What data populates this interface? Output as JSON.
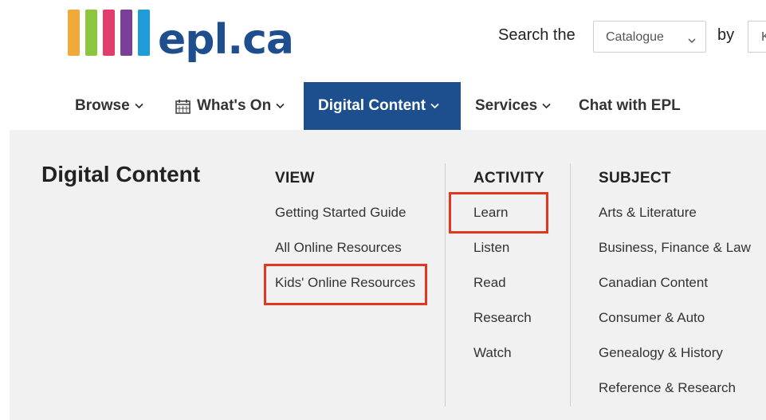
{
  "logo": {
    "text": "epl.ca",
    "bar_colors": [
      "#f2a93b",
      "#8cc63f",
      "#e23e6d",
      "#7a3f98",
      "#1f9bd7"
    ],
    "text_color": "#1f4e8f"
  },
  "search": {
    "label": "Search the",
    "scope_value": "Catalogue",
    "by_label": "by",
    "by_value": "K"
  },
  "nav": {
    "items": [
      {
        "label": "Browse",
        "icon": "chevron-down-icon"
      },
      {
        "label": "What's On",
        "icon": "calendar-icon"
      },
      {
        "label": "Digital Content",
        "icon": "chevron-down-icon"
      },
      {
        "label": "Services",
        "icon": "chevron-down-icon"
      },
      {
        "label": "Chat with EPL"
      }
    ],
    "active_color": "#1d4f8e"
  },
  "menu": {
    "title": "Digital Content",
    "view": {
      "heading": "VIEW",
      "items": [
        "Getting Started Guide",
        "All Online Resources",
        "Kids' Online Resources"
      ]
    },
    "activity": {
      "heading": "ACTIVITY",
      "items": [
        "Learn",
        "Listen",
        "Read",
        "Research",
        "Watch"
      ]
    },
    "subject": {
      "heading": "SUBJECT",
      "items": [
        "Arts & Literature",
        "Business, Finance & Law",
        "Canadian Content",
        "Consumer & Auto",
        "Genealogy & History",
        "Reference & Research"
      ]
    },
    "highlight_color": "#e2371f"
  }
}
